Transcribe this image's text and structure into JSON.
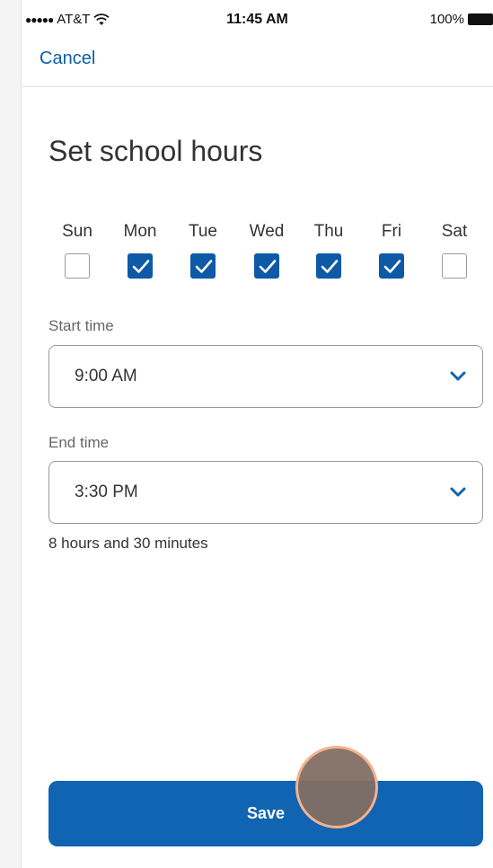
{
  "status_bar": {
    "signal": "●●●●●",
    "carrier": "AT&T",
    "time": "11:45 AM",
    "battery": "100%"
  },
  "nav": {
    "cancel_label": "Cancel"
  },
  "title": "Set school hours",
  "days": [
    {
      "label": "Sun",
      "checked": false
    },
    {
      "label": "Mon",
      "checked": true
    },
    {
      "label": "Tue",
      "checked": true
    },
    {
      "label": "Wed",
      "checked": true
    },
    {
      "label": "Thu",
      "checked": true
    },
    {
      "label": "Fri",
      "checked": true
    },
    {
      "label": "Sat",
      "checked": false
    }
  ],
  "start_time": {
    "label": "Start time",
    "value": "9:00 AM"
  },
  "end_time": {
    "label": "End time",
    "value": "3:30 PM"
  },
  "duration_text": "8 hours and 30 minutes",
  "save_label": "Save",
  "colors": {
    "accent": "#1064b1",
    "link": "#0b5fa5",
    "touch": "#826e64"
  },
  "icons": {
    "chevron": "chevron-down-icon",
    "check": "check-icon",
    "wifi": "wifi-icon",
    "battery": "battery-icon"
  }
}
